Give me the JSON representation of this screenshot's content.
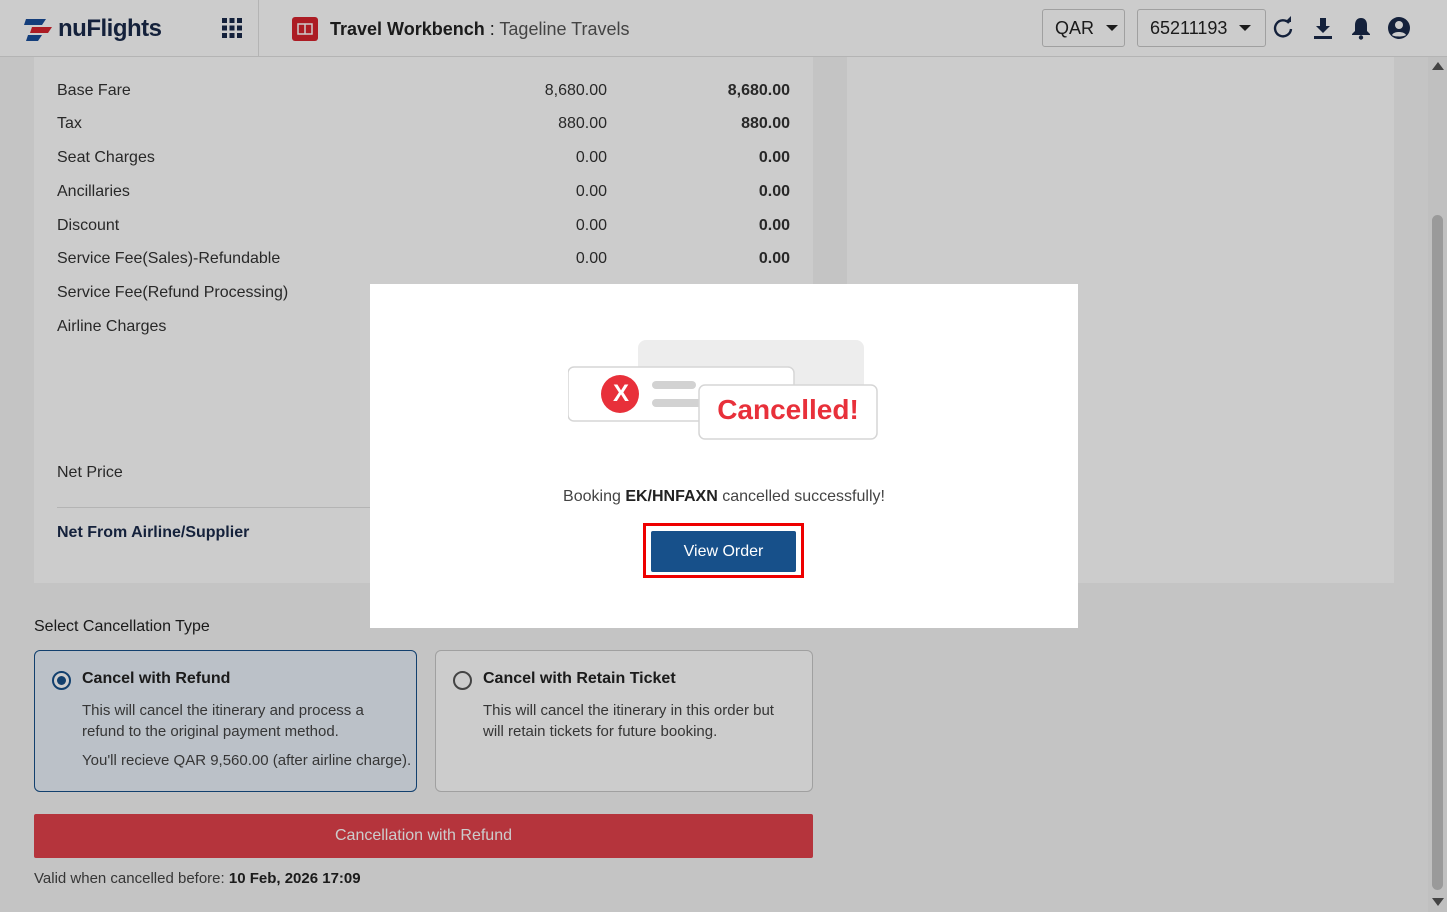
{
  "header": {
    "logo_text": "nuFlights",
    "title_main": "Travel Workbench",
    "title_sep": " : ",
    "title_sub": "Tageline Travels",
    "currency": "QAR",
    "account": "65211193",
    "icons": [
      "apps-grid-icon",
      "refresh-icon",
      "download-icon",
      "bell-icon",
      "user-icon"
    ]
  },
  "fare": {
    "rows": [
      {
        "label": "Base Fare",
        "v1": "8,680.00",
        "v2": "8,680.00"
      },
      {
        "label": "Tax",
        "v1": "880.00",
        "v2": "880.00"
      },
      {
        "label": "Seat Charges",
        "v1": "0.00",
        "v2": "0.00"
      },
      {
        "label": "Ancillaries",
        "v1": "0.00",
        "v2": "0.00"
      },
      {
        "label": "Discount",
        "v1": "0.00",
        "v2": "0.00"
      },
      {
        "label": "Service Fee(Sales)-Refundable",
        "v1": "0.00",
        "v2": "0.00"
      },
      {
        "label": "Service Fee(Refund Processing)",
        "v1": "",
        "v2": ""
      },
      {
        "label": "Airline Charges",
        "v1": "",
        "v2": ""
      }
    ],
    "net_price_label": "Net Price",
    "net_supplier_label": "Net From Airline/Supplier"
  },
  "cancellation": {
    "heading": "Select Cancellation Type",
    "options": [
      {
        "title": "Cancel with Refund",
        "desc": "This will cancel the itinerary and process a refund to the original payment method.",
        "note": "You'll recieve QAR 9,560.00 (after airline charge).",
        "selected": true
      },
      {
        "title": "Cancel with Retain Ticket",
        "desc": "This will cancel the itinerary in this order but will retain tickets for future booking.",
        "note": "",
        "selected": false
      }
    ],
    "button": "Cancellation with Refund",
    "valid_prefix": "Valid when cancelled before: ",
    "valid_date": "10 Feb, 2026 17:09"
  },
  "modal": {
    "badge_text": "Cancelled!",
    "badge_x": "X",
    "msg_prefix": "Booking ",
    "pnr": "EK/HNFAXN",
    "msg_suffix": " cancelled successfully!",
    "button": "View Order"
  },
  "colors": {
    "primary": "#17508a",
    "danger": "#e3414b",
    "brand_red": "#d8242e"
  }
}
